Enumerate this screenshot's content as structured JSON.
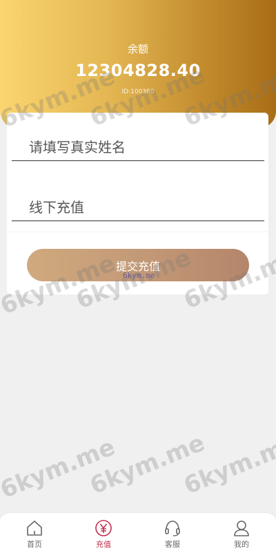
{
  "header": {
    "balance_label": "余额",
    "balance_amount": "12304828.40",
    "user_id": "ID:100380"
  },
  "form": {
    "name_placeholder": "请填写真实姓名",
    "method_placeholder": "线下充值",
    "submit_label": "提交充值"
  },
  "watermark": {
    "text": "6kym.me",
    "small_text": "6kym.me"
  },
  "tabbar": {
    "items": [
      {
        "label": "首页",
        "icon": "home-icon",
        "active": false
      },
      {
        "label": "充值",
        "icon": "yen-icon",
        "active": true
      },
      {
        "label": "客服",
        "icon": "headset-icon",
        "active": false
      },
      {
        "label": "我的",
        "icon": "user-icon",
        "active": false
      }
    ]
  },
  "colors": {
    "accent": "#c0304a",
    "header_start": "#fbd56f",
    "header_end": "#a96d17",
    "button_start": "#d0a97e",
    "button_end": "#b4856a"
  }
}
